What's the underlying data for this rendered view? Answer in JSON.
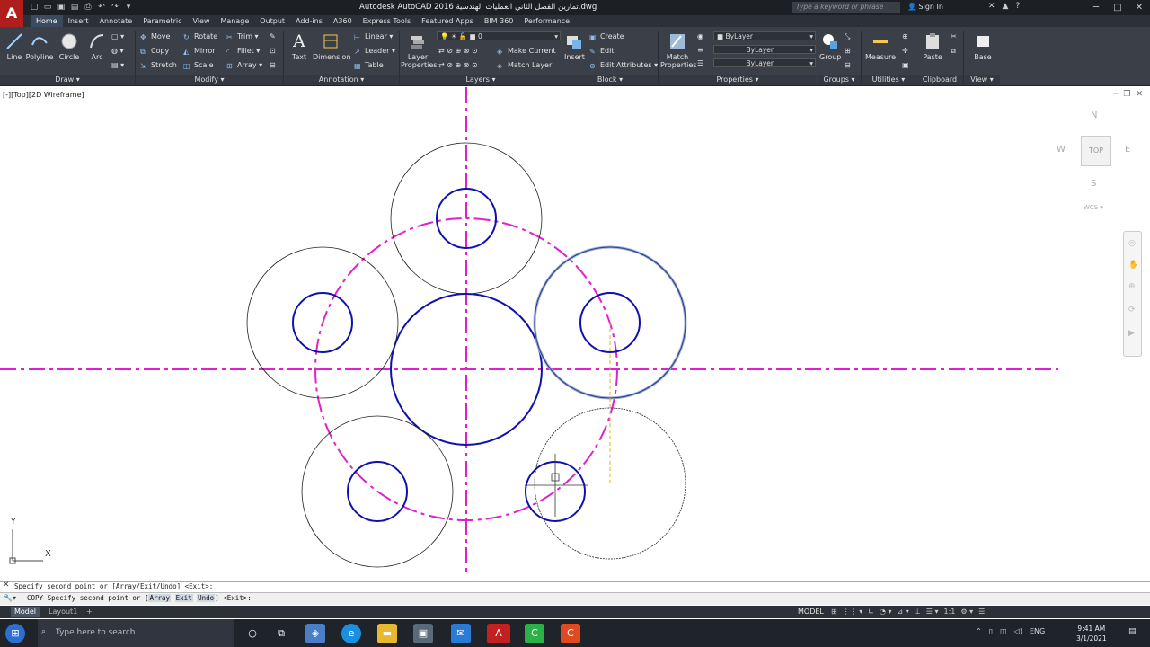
{
  "app": {
    "logo_letter": "A",
    "title": "Autodesk AutoCAD 2016    تمارين الفصل الثاني العمليات الهندسية.dwg"
  },
  "search": {
    "placeholder": "Type a keyword or phrase"
  },
  "account": {
    "signin_label": "Sign In"
  },
  "tabs": [
    "Home",
    "Insert",
    "Annotate",
    "Parametric",
    "View",
    "Manage",
    "Output",
    "Add-ins",
    "A360",
    "Express Tools",
    "Featured Apps",
    "BIM 360",
    "Performance"
  ],
  "ribbon": {
    "draw": {
      "title": "Draw",
      "line": "Line",
      "polyline": "Polyline",
      "circle": "Circle",
      "arc": "Arc"
    },
    "modify": {
      "title": "Modify",
      "move": "Move",
      "rotate": "Rotate",
      "trim": "Trim",
      "copy": "Copy",
      "mirror": "Mirror",
      "fillet": "Fillet",
      "stretch": "Stretch",
      "scale": "Scale",
      "array": "Array"
    },
    "annotation": {
      "title": "Annotation",
      "text": "Text",
      "dimension": "Dimension",
      "linear": "Linear",
      "leader": "Leader",
      "table": "Table"
    },
    "layers": {
      "title": "Layers",
      "layer_properties": "Layer Properties",
      "current_layer": "0",
      "make_current": "Make Current",
      "match_layer": "Match Layer"
    },
    "block": {
      "title": "Block",
      "insert": "Insert",
      "create": "Create",
      "edit": "Edit",
      "edit_attributes": "Edit Attributes"
    },
    "properties": {
      "title": "Properties",
      "match": "Match Properties",
      "color": "ByLayer",
      "linetype": "ByLayer",
      "lineweight": "ByLayer"
    },
    "groups": {
      "title": "Groups",
      "group": "Group"
    },
    "utilities": {
      "title": "Utilities",
      "measure": "Measure"
    },
    "clipboard": {
      "title": "Clipboard",
      "paste": "Paste"
    },
    "view": {
      "title": "View",
      "base": "Base"
    }
  },
  "viewport": {
    "label": "[-][Top][2D Wireframe]",
    "viewcube": {
      "n": "N",
      "s": "S",
      "e": "E",
      "w": "W",
      "face": "TOP",
      "wcs": "WCS"
    },
    "ucs": {
      "x": "X",
      "y": "Y"
    },
    "colors": {
      "center_line": "#e020d0",
      "object": "#1010b0",
      "construction": "#222222"
    }
  },
  "command": {
    "history": "Specify second point or [Array/Exit/Undo] <Exit>:",
    "prompt_prefix": "COPY Specify second point or [",
    "opt_array": "Array",
    "opt_exit": "Exit",
    "opt_undo": "Undo",
    "prompt_suffix": "] <Exit>:"
  },
  "layout_tabs": [
    "Model",
    "Layout1"
  ],
  "status": {
    "model": "MODEL",
    "scale": "1:1"
  },
  "taskbar": {
    "search_placeholder": "Type here to search",
    "lang": "ENG",
    "time": "9:41 AM",
    "date": "3/1/2021"
  }
}
